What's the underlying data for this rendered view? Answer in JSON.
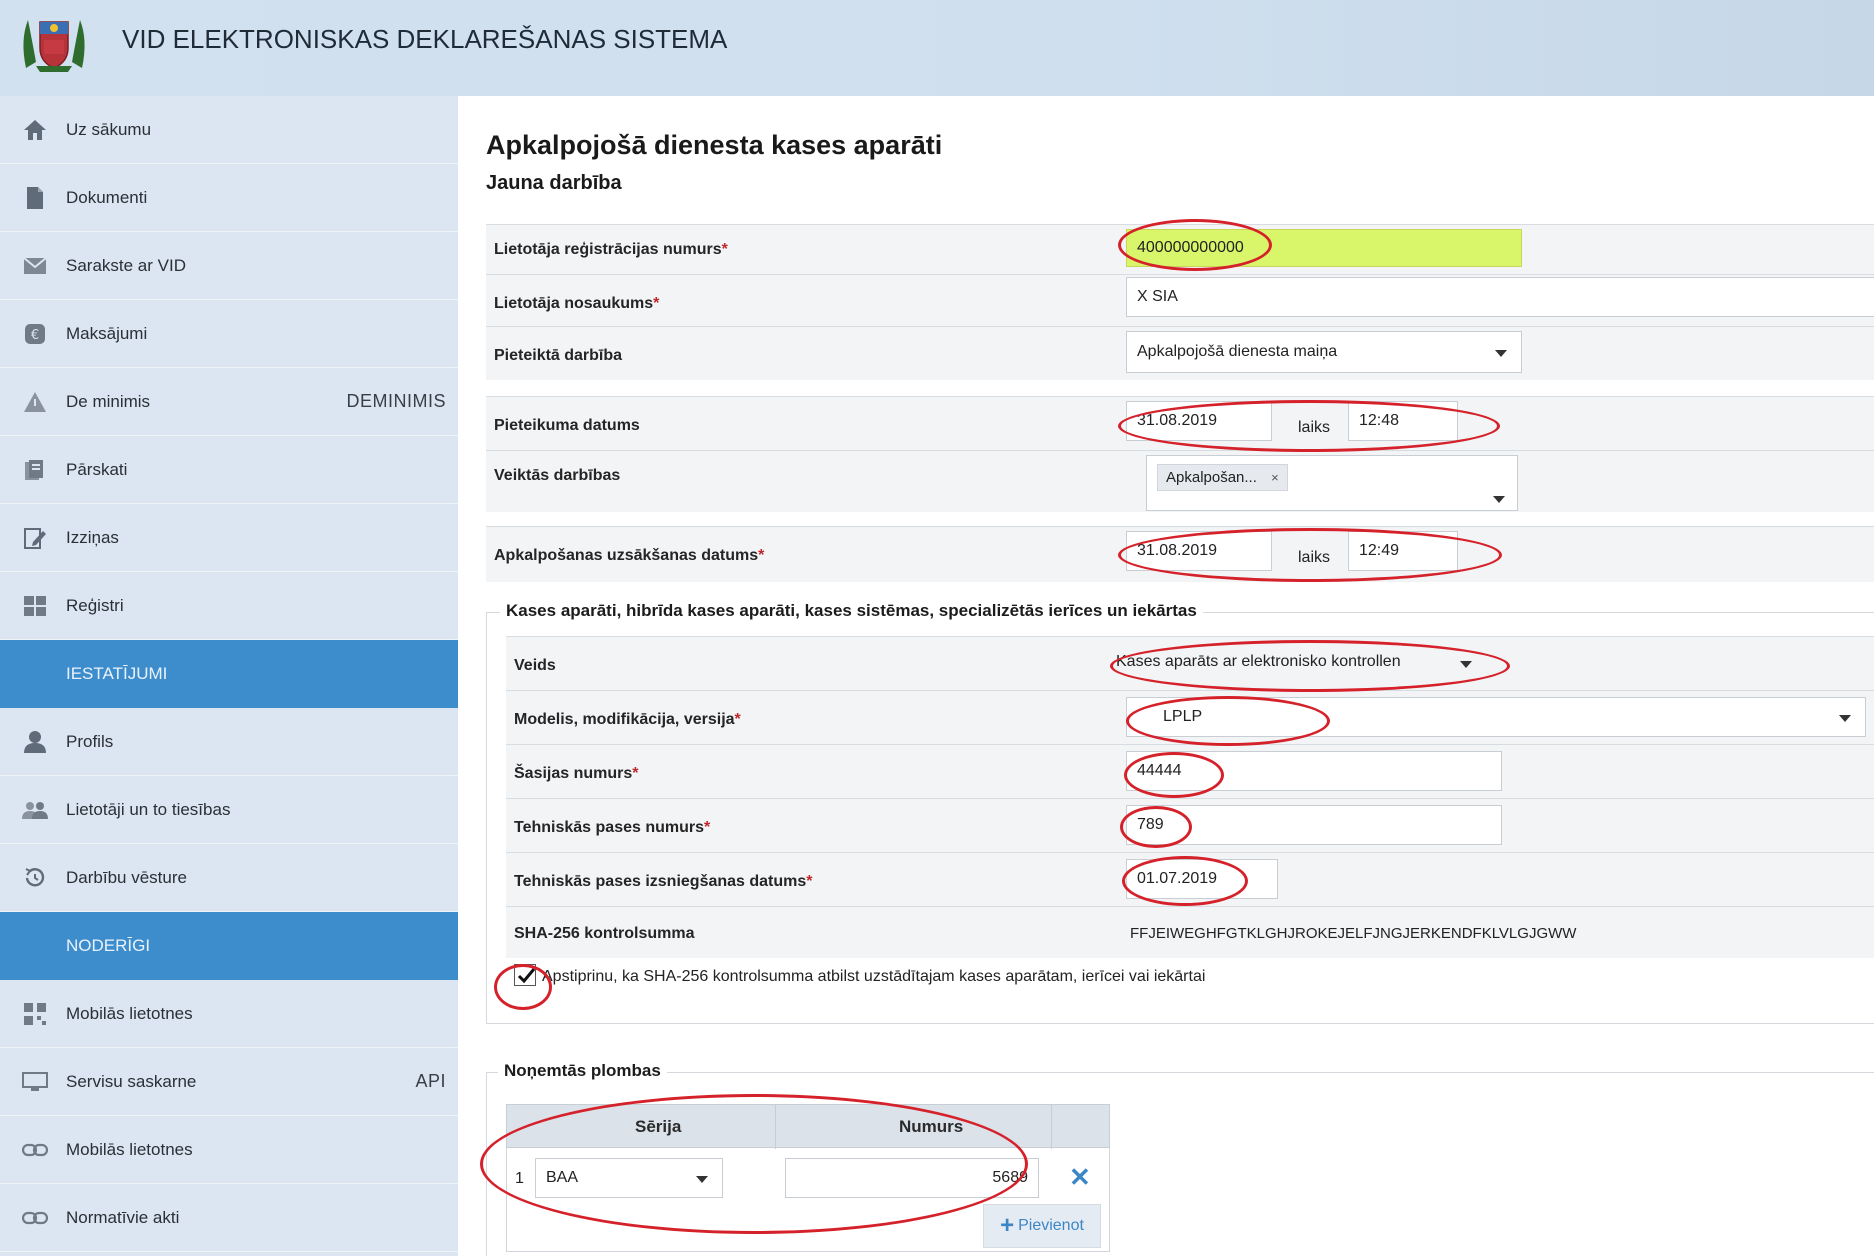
{
  "header": {
    "title": "VID ELEKTRONISKAS DEKLAREŠANAS SISTEMA"
  },
  "sidebar": {
    "items": [
      {
        "label": "Uz sākumu",
        "icon": "home-icon"
      },
      {
        "label": "Dokumenti",
        "icon": "document-icon"
      },
      {
        "label": "Sarakste ar VID",
        "icon": "mail-icon"
      },
      {
        "label": "Maksājumi",
        "icon": "payment-icon"
      },
      {
        "label": "De minimis",
        "icon": "warning-icon",
        "badge": "DEMINIMIS"
      },
      {
        "label": "Pārskati",
        "icon": "reports-icon"
      },
      {
        "label": "Izziņas",
        "icon": "edit-document-icon"
      },
      {
        "label": "Reģistri",
        "icon": "grid-icon"
      },
      {
        "label": "Profils",
        "icon": "user-icon"
      },
      {
        "label": "Lietotāji un to tiesības",
        "icon": "users-icon"
      },
      {
        "label": "Darbību vēsture",
        "icon": "history-icon"
      },
      {
        "label": "Mobilās lietotnes",
        "icon": "qr-icon"
      },
      {
        "label": "Servisu saskarne",
        "icon": "api-icon",
        "badge": "API"
      },
      {
        "label": "Mobilās lietotnes",
        "icon": "link-icon"
      },
      {
        "label": "Normatīvie akti",
        "icon": "link-icon"
      }
    ],
    "sections": {
      "settings": "IESTATĪJUMI",
      "useful": "NODERĪGI"
    }
  },
  "main": {
    "title": "Apkalpojošā dienesta kases aparāti",
    "subtitle": "Jauna darbība",
    "fields": {
      "reg_number": {
        "label": "Lietotāja reģistrācijas numurs",
        "value": "400000000000"
      },
      "user_name": {
        "label": "Lietotāja nosaukums",
        "value": "X SIA"
      },
      "action": {
        "label": "Pieteiktā darbība",
        "value": "Apkalpojošā dienesta maiņa"
      },
      "application_date": {
        "label": "Pieteikuma datums",
        "date": "31.08.2019",
        "time_label": "laiks",
        "time": "12:48"
      },
      "performed": {
        "label": "Veiktās darbības",
        "tag": "Apkalpošan...",
        "tag_remove": "×"
      },
      "service_start": {
        "label": "Apkalpošanas uzsākšanas datums",
        "date": "31.08.2019",
        "time_label": "laiks",
        "time": "12:49"
      }
    },
    "device_section": {
      "legend": "Kases aparāti, hibrīda kases aparāti, kases sistēmas, specializētās ierīces un iekārtas",
      "type": {
        "label": "Veids",
        "value": "Kases aparāts ar elektronisko kontrollen"
      },
      "model": {
        "label": "Modelis, modifikācija, versija",
        "value": "LPLP"
      },
      "chassis": {
        "label": "Šasijas numurs",
        "value": "44444"
      },
      "passport": {
        "label": "Tehniskās pases numurs",
        "value": "789"
      },
      "passport_date": {
        "label": "Tehniskās pases izsniegšanas datums",
        "value": "01.07.2019"
      },
      "sha": {
        "label": "SHA-256 kontrolsumma",
        "value": "FFJEIWEGHFGTKLGHJROKEJELFJNGJERKENDFKLVLGJGWW"
      },
      "confirm": {
        "label": "Apstiprinu, ka SHA-256 kontrolsumma atbilst uzstādītajam kases aparātam, ierīcei vai iekārtai",
        "checked": true
      }
    },
    "seals": {
      "legend": "Noņemtās plombas",
      "columns": [
        "Sērija",
        "Numurs"
      ],
      "rows": [
        {
          "index": "1",
          "series": "BAA",
          "number": "5689"
        }
      ],
      "add_label": "Pievienot",
      "add_icon": "+",
      "remove_icon": "✕"
    }
  },
  "colors": {
    "accent": "#3d8dcc",
    "sidebar": "#dbe6f2",
    "highlight_input": "#d9f56a",
    "annotation": "#d5212a"
  }
}
